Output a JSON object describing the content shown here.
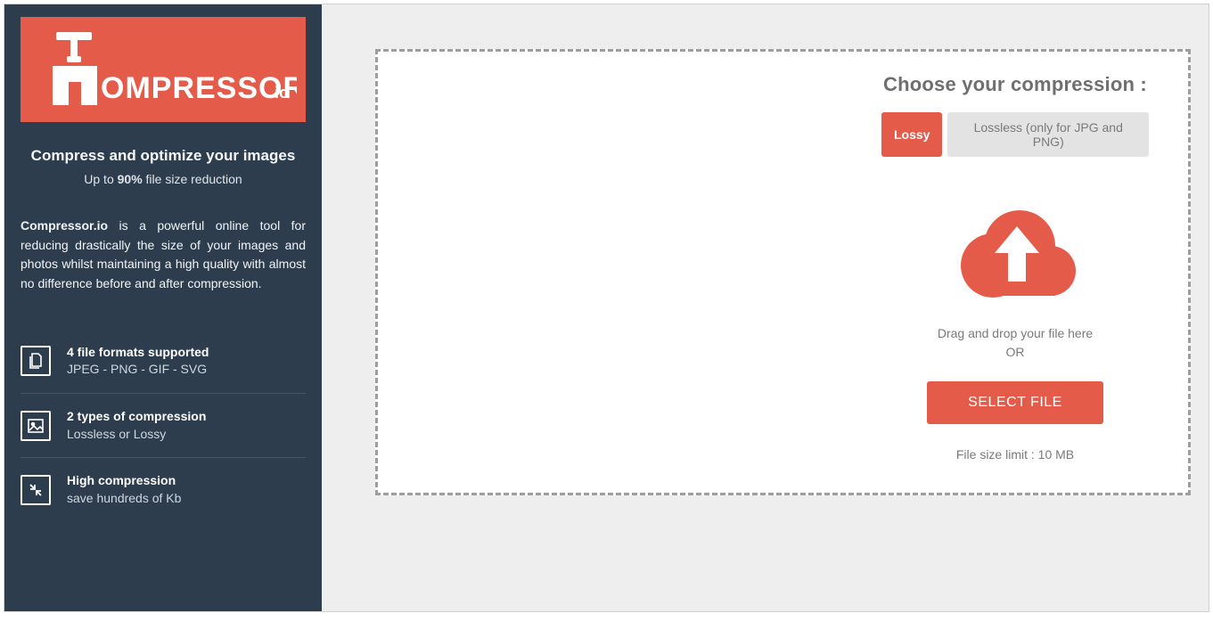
{
  "brand": {
    "name": "OMPRESSOR",
    "suffix": ".io"
  },
  "tagline": "Compress and optimize your images",
  "subtag_pre": "Up to ",
  "subtag_bold": "90%",
  "subtag_post": " file size reduction",
  "desc_bold": "Compressor.io",
  "desc_rest": " is a powerful online tool for reducing drastically the size of your images and photos whilst maintaining a high quality with almost no difference before and after compression.",
  "features": [
    {
      "title": "4 file formats supported",
      "sub": "JPEG - PNG - GIF - SVG"
    },
    {
      "title": "2 types of compression",
      "sub": "Lossless or Lossy"
    },
    {
      "title": "High compression",
      "sub": "save hundreds of Kb"
    }
  ],
  "main": {
    "choose": "Choose your compression :",
    "lossy": "Lossy",
    "lossless": "Lossless (only for JPG and PNG)",
    "drag": "Drag and drop your file here",
    "or": "OR",
    "select": "SELECT FILE",
    "limit": "File size limit : 10 MB"
  },
  "colors": {
    "accent": "#e55b4a",
    "sidebar": "#2e3d4e"
  }
}
